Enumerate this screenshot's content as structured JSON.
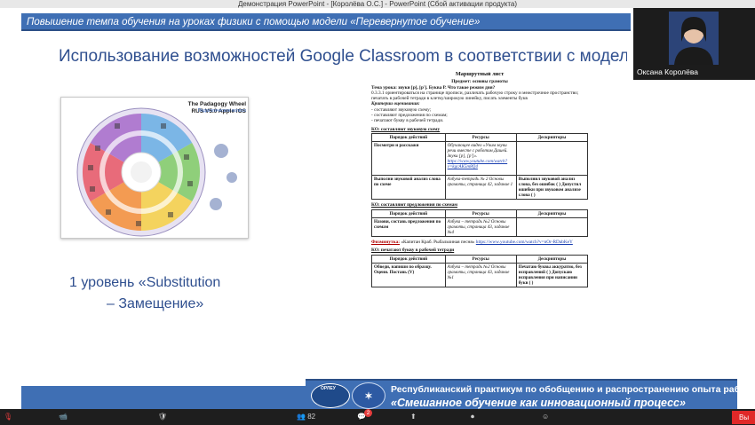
{
  "window": {
    "title": "Демонстрация PowerPoint - [Королёва О.С.] - PowerPoint (Сбой активации продукта)"
  },
  "slide": {
    "banner": "Повышение темпа обучения на уроках физики с помощью модели «Перевернутое обучение»",
    "title": "Использование возможностей Google Classroom в соответствии с моделью",
    "wheel_title": "The Padagogy Wheel RUS V5.0 Apple iOS",
    "wheel_subtitle": "Педагогическое колесо",
    "level_line1": "1 уровень «Substitution",
    "level_line2": "– Замещение»",
    "sheet": {
      "heading": "Маршрутный лист",
      "subject": "Предмет: основы грамоты",
      "topic": "Тема урока: звуки [р], [р']. Буква Р. Что такое режим дня?",
      "goal": "0.3.3.1 ориентироваться на странице прописи, различать рабочую строку и межстрочное пространство; печатать в рабочей тетради в клетку/широкую линейку, писать элементы букв",
      "criteria_title": "Критерии оценивания:",
      "criteria": [
        "- составляют звуковую схему;",
        "- составляют предложения по схемам;",
        "- печатают букву в рабочей тетради."
      ],
      "section1": "КО: составляют звуковую схему",
      "headers": [
        "Порядок действий",
        "Ресурсы",
        "Дескрипторы"
      ],
      "table1": [
        {
          "action": "Посмотри и расскажи",
          "resource": "Обучающее видео «Учим звуки речи вместе с роботом Дашей. Звуки [р], [р']».",
          "link": "https://www.youtube.com/watch?v=kgcAK5m8Q4",
          "descriptor": ""
        },
        {
          "action": "Выполни звуковой анализ слова по схеме",
          "resource": "Азбука-тетрадь № 2 Основы грамоты, страница 42, задание 1",
          "link": "",
          "descriptor": "Выполнил звуковой анализ слова, без ошибок ( ) Допустил ошибки при звуковом анализе слова ( )"
        }
      ],
      "section2": "КО: составляют предложения по схемам",
      "table2": [
        {
          "action": "Назови, составь предложения по схемам",
          "resource": "Азбука – тетрадь №2 Основы грамоты, страница 43, задание №4",
          "descriptor": ""
        }
      ],
      "fizminutka_label": "Физминутка:",
      "fizminutka_text": "«Капитан Краб. Рыбальчиная песня»",
      "fizminutka_link": "https://www.youtube.com/watch?v=nOr-RDabKeY",
      "section3": "КО: печатают букву в рабочей тетради",
      "table3": [
        {
          "action": "Обведи, напиши по образцу. Оцени. Поставь (V)",
          "resource": "Азбука – тетрадь №2 Основы грамоты, страница 43, задание №1",
          "descriptor": "Печатаю буквы аккуратно, без исправлений ( ) Допускаю исправления при написании букв ( )"
        }
      ]
    },
    "footer": {
      "logo_text": "ОРЛЕУ",
      "line1": "Республиканский практикум по обобщению и распространению опыта работы",
      "line2": "«Смешанное обучение как инновационный процесс»"
    }
  },
  "video": {
    "participant_name": "Оксана Королёва"
  },
  "zoom_toolbar": {
    "participants_count": "82",
    "chat_badge": "2",
    "end_label": "Вы"
  },
  "colors": {
    "brand_blue": "#3f6fb4",
    "title_blue": "#2f4f8f",
    "end_red": "#e02828"
  }
}
